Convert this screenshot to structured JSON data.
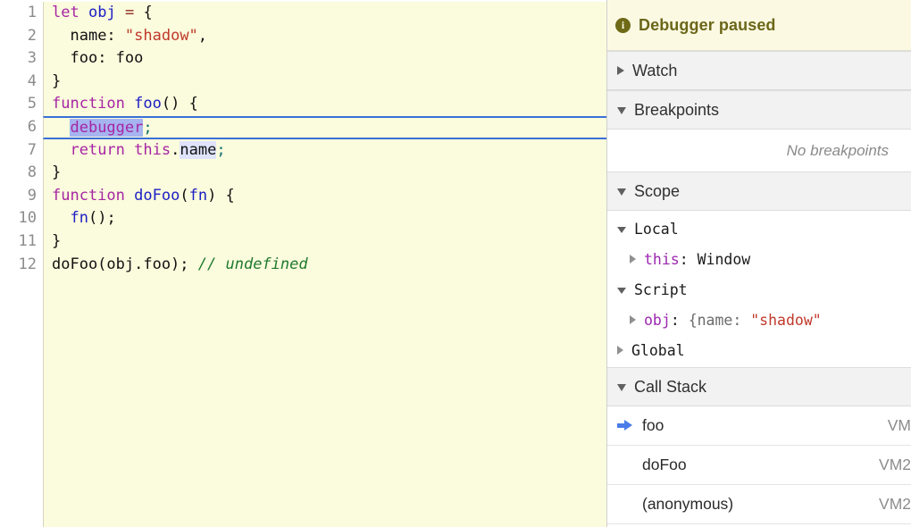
{
  "editor": {
    "language": "javascript",
    "background_color": "#fbfbdd",
    "gutter_color": "#ffffff",
    "exec_line_number": 6,
    "exec_line_border_color": "#3a6fd8",
    "selection_strong_color": "#a6b4f0",
    "selection_light_color": "#dfe3fb",
    "lines": [
      {
        "num": "1",
        "text": "let obj = {"
      },
      {
        "num": "2",
        "text": "  name: \"shadow\","
      },
      {
        "num": "3",
        "text": "  foo: foo"
      },
      {
        "num": "4",
        "text": "}"
      },
      {
        "num": "5",
        "text": "function foo() {"
      },
      {
        "num": "6",
        "text": "  debugger;"
      },
      {
        "num": "7",
        "text": "  return this.name;"
      },
      {
        "num": "8",
        "text": "}"
      },
      {
        "num": "9",
        "text": "function doFoo(fn) {"
      },
      {
        "num": "10",
        "text": "  fn();"
      },
      {
        "num": "11",
        "text": "}"
      },
      {
        "num": "12",
        "text": "doFoo(obj.foo); // undefined"
      }
    ],
    "tokens": {
      "l1_let": "let",
      "l1_sp1": " ",
      "l1_obj": "obj",
      "l1_sp2": " ",
      "l1_eq": "=",
      "l1_sp3": " ",
      "l1_brace": "{",
      "l2_indent": "  ",
      "l2_key": "name: ",
      "l2_str": "\"shadow\"",
      "l2_comma": ",",
      "l3_indent": "  ",
      "l3_text": "foo: foo",
      "l4_text": "}",
      "l5_fn": "function",
      "l5_sp": " ",
      "l5_name": "foo",
      "l5_rest": "() {",
      "l6_indent": "  ",
      "l6_dbg": "debugger",
      "l6_semi": ";",
      "l7_indent": "  ",
      "l7_return": "return",
      "l7_sp": " ",
      "l7_this": "this",
      "l7_dot": ".",
      "l7_name": "name",
      "l7_semi": ";",
      "l8_text": "}",
      "l9_fn": "function",
      "l9_sp": " ",
      "l9_name": "doFoo",
      "l9_p1": "(",
      "l9_arg": "fn",
      "l9_p2": ") {",
      "l10_indent": "  ",
      "l10_fn": "fn",
      "l10_rest": "();",
      "l11_text": "}",
      "l12_call": "doFoo(obj.foo);",
      "l12_sp": " ",
      "l12_comment": "// undefined"
    }
  },
  "panel": {
    "paused": {
      "icon": "info-icon",
      "label": "Debugger paused",
      "background_color": "#fcf9e3",
      "text_color": "#6b6719"
    },
    "sections": [
      {
        "id": "watch",
        "label": "Watch",
        "expanded": false
      },
      {
        "id": "breakpoints",
        "label": "Breakpoints",
        "expanded": true
      },
      {
        "id": "scope",
        "label": "Scope",
        "expanded": true
      },
      {
        "id": "callstack",
        "label": "Call Stack",
        "expanded": true
      }
    ],
    "breakpoints": {
      "empty_text": "No breakpoints"
    },
    "scope": {
      "groups": [
        {
          "name": "Local",
          "expanded": true,
          "entries": [
            {
              "expanded": false,
              "key": "this",
              "separator": ": ",
              "value": "Window",
              "value_kind": "plain"
            }
          ]
        },
        {
          "name": "Script",
          "expanded": true,
          "entries": [
            {
              "expanded": false,
              "key": "obj",
              "separator": ": ",
              "value_prefix": "{name: ",
              "value_string": "\"shadow\"",
              "value_kind": "object"
            }
          ]
        },
        {
          "name": "Global",
          "expanded": false,
          "entries": []
        }
      ]
    },
    "call_stack": {
      "frames": [
        {
          "name": "foo",
          "location": "VM",
          "current": true
        },
        {
          "name": "doFoo",
          "location": "VM2",
          "current": false
        },
        {
          "name": "(anonymous)",
          "location": "VM2",
          "current": false
        }
      ],
      "current_marker": "right-arrow-icon",
      "current_marker_color": "#4a7ce8"
    }
  }
}
